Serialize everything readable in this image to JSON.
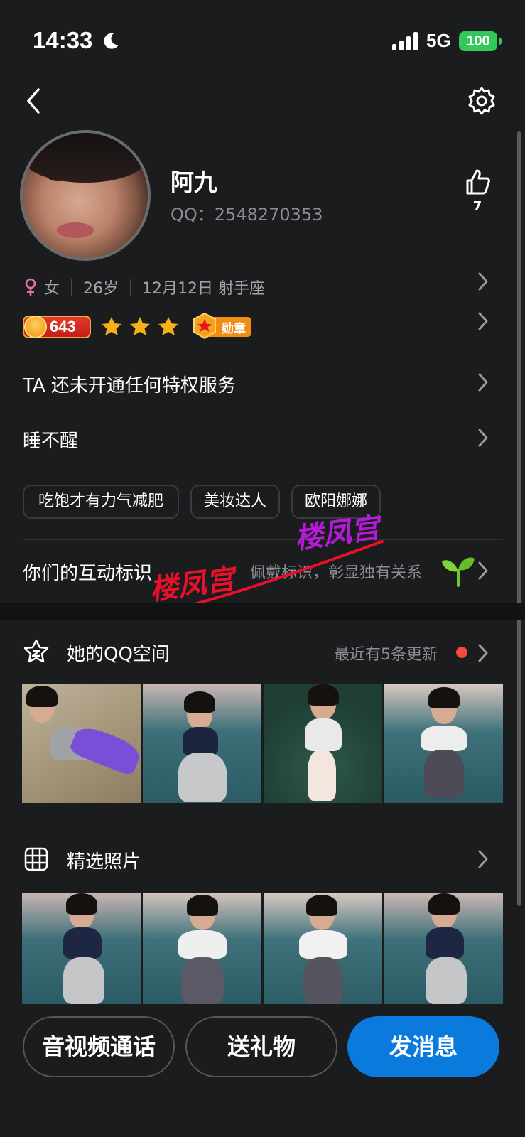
{
  "status_bar": {
    "time": "14:33",
    "network": "5G",
    "battery": "100"
  },
  "profile": {
    "nickname": "阿九",
    "qq_label": "QQ：",
    "qq_number": "2548270353",
    "like_count": "7"
  },
  "info": {
    "gender": "女",
    "age": "26岁",
    "birthday": "12月12日 射手座"
  },
  "badges": {
    "level": "643",
    "star_count": 3,
    "medal_label": "勋章"
  },
  "privilege_text": "TA 还未开通任何特权服务",
  "signature": "睡不醒",
  "tags": [
    "吃饱才有力气减肥",
    "美妆达人",
    "欧阳娜娜"
  ],
  "interaction": {
    "title": "你们的互动标识",
    "hint": "佩戴标识，彰显独有关系"
  },
  "watermarks": [
    "楼凤宫",
    "楼凤宫"
  ],
  "qzone": {
    "title": "她的QQ空间",
    "update_text": "最近有5条更新"
  },
  "featured": {
    "title": "精选照片"
  },
  "actions": {
    "call": "音视频通话",
    "gift": "送礼物",
    "message": "发消息"
  },
  "colors": {
    "primary": "#0a7bdc",
    "background": "#1b1c1e",
    "badge_dot": "#f24a3c",
    "battery": "#34c759",
    "watermark_red": "#e8102a",
    "watermark_purple": "#b51ad6"
  }
}
